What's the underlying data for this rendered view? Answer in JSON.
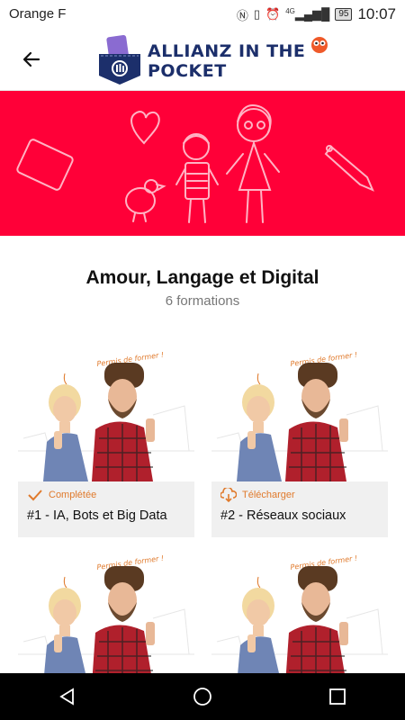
{
  "status_bar": {
    "carrier": "Orange F",
    "signal": "4G",
    "battery": "95",
    "time": "10:07"
  },
  "app_bar": {
    "back_icon": "arrow-left-icon",
    "logo_text": "ALLIANZ IN THE POCKET",
    "brand_color": "#1c2f6b"
  },
  "banner": {
    "color": "#ff0038"
  },
  "page": {
    "title": "Amour, Langage et Digital",
    "subtitle": "6 formations"
  },
  "cards": [
    {
      "status_label": "Complétée",
      "status_icon": "check-icon",
      "title": "#1 - IA, Bots et Big Data",
      "poster_caption": "Permis de former !"
    },
    {
      "status_label": "Télécharger",
      "status_icon": "cloud-download-icon",
      "title": "#2 - Réseaux sociaux",
      "poster_caption": "Permis de former !"
    },
    {
      "status_label": "",
      "status_icon": "",
      "title": "",
      "poster_caption": "Permis de former !"
    },
    {
      "status_label": "",
      "status_icon": "",
      "title": "",
      "poster_caption": "Permis de former !"
    }
  ],
  "accent_color": "#e07a2c",
  "nav_bar": {
    "back": "triangle-back-icon",
    "home": "circle-home-icon",
    "recents": "square-recents-icon"
  }
}
